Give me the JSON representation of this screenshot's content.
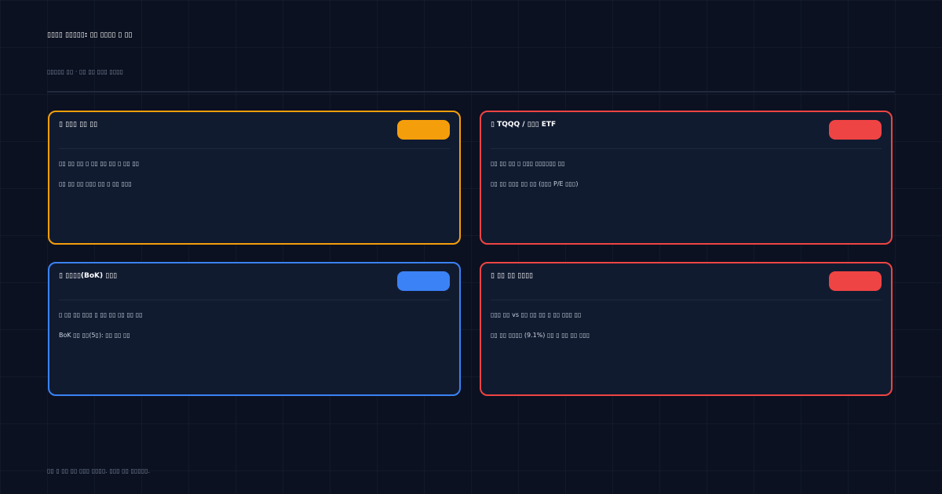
{
  "header": {
    "title": "▯▯▯▯ ▯▯▯▯▯: ▯▯ ▯▯▯▯ ▯ ▯▯",
    "subtitle": "▯▯▯▯▯ ▯▯ · ▯▯ ▯▯ ▯▯▯ ▯▯▯▯"
  },
  "cards": [
    {
      "title": "▯ ▯▯▯ ▯▯ ▯▯",
      "color": "#f59e0b",
      "lines": [
        "▯▯ ▯▯ ▯▯ ▯ ▯▯ ▯▯ ▯▯ ▯ ▯▯ ▯▯",
        "▯▯ ▯▯ ▯▯ ▯▯▯ ▯▯ ▯ ▯▯ ▯▯▯"
      ]
    },
    {
      "title": "▯ TQQQ / ▯▯▯ ETF",
      "color": "#ef4444",
      "lines": [
        "▯▯ ▯▯ ▯▯ ▯ ▯▯▯ ▯▯▯▯▯▯ ▯▯",
        "▯▯ ▯▯ ▯▯▯ ▯▯ ▯▯ (▯▯▯ P/E ▯▯▯)"
      ]
    },
    {
      "title": "▯ ▯▯▯▯(BoK) ▯▯▯",
      "color": "#3b82f6",
      "lines": [
        "▯ ▯▯ ▯▯ ▯▯▯ ▯ ▯▯ ▯▯ ▯▯ ▯▯ ▯▯",
        "BoK ▯▯ ▯▯(5▯): ▯▯ ▯▯ ▯▯"
      ]
    },
    {
      "title": "▯ ▯▯ ▯▯ ▯▯▯▯",
      "color": "#ef4444",
      "lines": [
        "▯▯▯ ▯▯ vs ▯▯ ▯▯ ▯▯ ▯ ▯▯ ▯▯▯ ▯▯",
        "▯▯ ▯▯ ▯▯▯▯ (9.1%) ▯▯ ▯ ▯▯ ▯▯ ▯▯▯"
      ]
    }
  ],
  "footer": "▯▯  ▯ ▯▯ ▯▯ ▯▯▯ ▯▯▯▯. ▯▯▯ ▯▯ ▯▯▯▯▯."
}
